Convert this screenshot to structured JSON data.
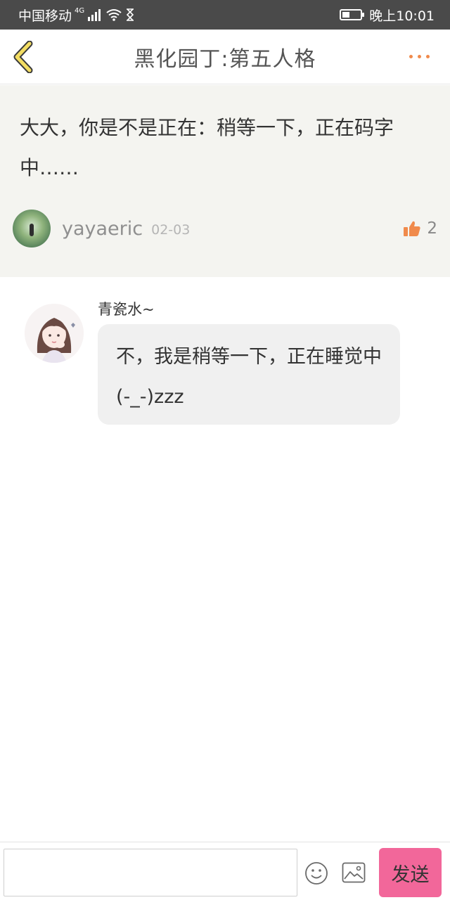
{
  "status_bar": {
    "carrier": "中国移动",
    "network": "4G",
    "time": "晚上10:01",
    "battery_level": 0.4
  },
  "header": {
    "title": "黑化园丁:第五人格"
  },
  "post": {
    "text": "大大，你是不是正在：稍等一下，正在码字中……",
    "username": "yayaeric",
    "date": "02-03",
    "likes": "2"
  },
  "reply": {
    "username": "青瓷水~",
    "text": "不，我是稍等一下，正在睡觉中(-_-)zzz"
  },
  "input_bar": {
    "placeholder": "",
    "send_label": "发送"
  },
  "colors": {
    "accent_orange": "#f08a4b",
    "back_icon_yellow": "#f3dd62",
    "send_button_pink": "#f2679a",
    "post_background": "#f4f4f0"
  },
  "icons": [
    "back-arrow-icon",
    "more-dots-icon",
    "thumbs-up-icon",
    "emoji-icon",
    "image-icon",
    "signal-icon",
    "wifi-icon",
    "hourglass-icon",
    "battery-icon"
  ]
}
